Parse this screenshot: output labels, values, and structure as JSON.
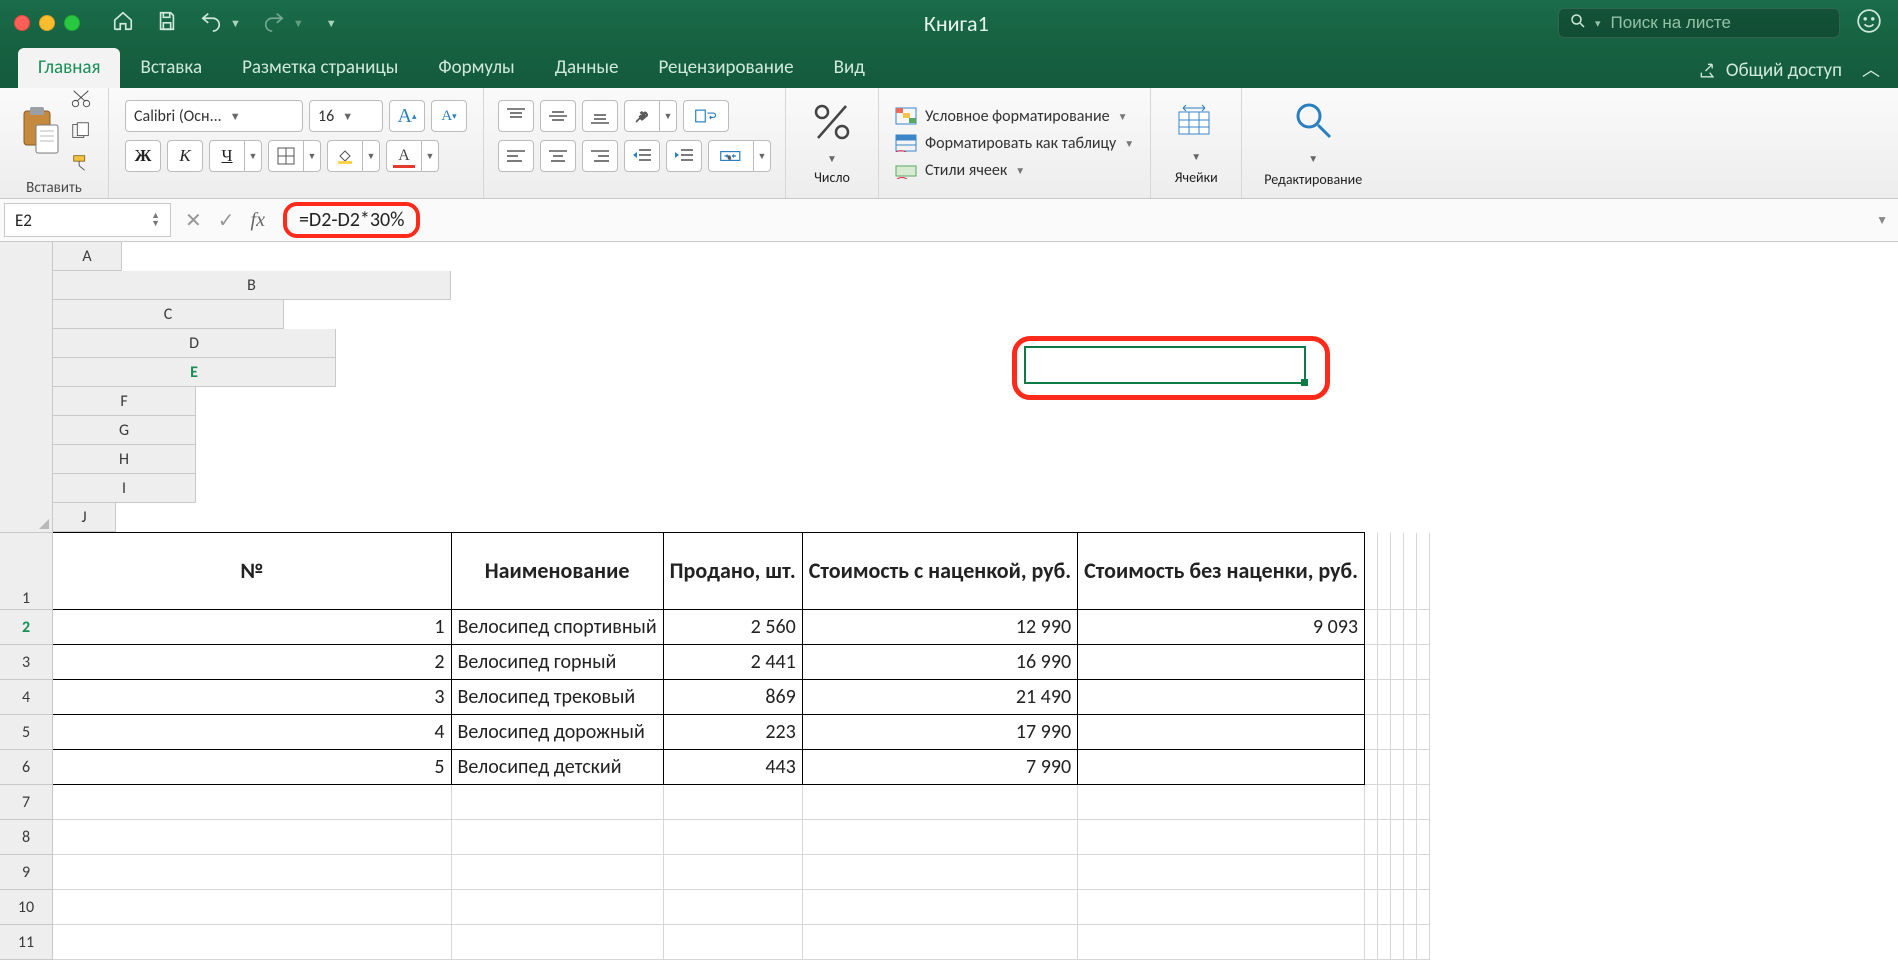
{
  "titlebar": {
    "title": "Книга1",
    "search_placeholder": "Поиск на листе"
  },
  "tabs": {
    "home": "Главная",
    "insert": "Вставка",
    "layout": "Разметка страницы",
    "formulas": "Формулы",
    "data": "Данные",
    "review": "Рецензирование",
    "view": "Вид",
    "share": "Общий доступ"
  },
  "ribbon": {
    "paste": "Вставить",
    "font_name": "Calibri (Осн...",
    "font_size": "16",
    "bold": "Ж",
    "italic": "К",
    "underline": "Ч",
    "fontcolor_letter": "А",
    "bigA": "A",
    "smallA": "A",
    "number": "Число",
    "cond_format": "Условное форматирование",
    "table_format": "Форматировать как таблицу",
    "cell_styles": "Стили ячеек",
    "cells": "Ячейки",
    "editing": "Редактирование"
  },
  "formula_bar": {
    "cell_ref": "E2",
    "fx_label": "fx",
    "formula": "=D2-D2*30%"
  },
  "columns": [
    "A",
    "B",
    "C",
    "D",
    "E",
    "F",
    "G",
    "H",
    "I",
    "J"
  ],
  "rows": [
    "1",
    "2",
    "3",
    "4",
    "5",
    "6",
    "7",
    "8",
    "9",
    "10",
    "11"
  ],
  "headers": {
    "num": "№",
    "name": "Наименование",
    "sold": "Продано, шт.",
    "cost_markup": "Стоимость с наценкой, руб.",
    "cost_plain": "Стоимость без наценки, руб."
  },
  "data": {
    "r1": {
      "n": "1",
      "name": "Велосипед спортивный",
      "sold": "2 560",
      "markup": "12 990",
      "plain": "9 093"
    },
    "r2": {
      "n": "2",
      "name": "Велосипед горный",
      "sold": "2 441",
      "markup": "16 990",
      "plain": ""
    },
    "r3": {
      "n": "3",
      "name": "Велосипед трековый",
      "sold": "869",
      "markup": "21 490",
      "plain": ""
    },
    "r4": {
      "n": "4",
      "name": "Велосипед дорожный",
      "sold": "223",
      "markup": "17 990",
      "plain": ""
    },
    "r5": {
      "n": "5",
      "name": "Велосипед детский",
      "sold": "443",
      "markup": "7 990",
      "plain": ""
    }
  }
}
